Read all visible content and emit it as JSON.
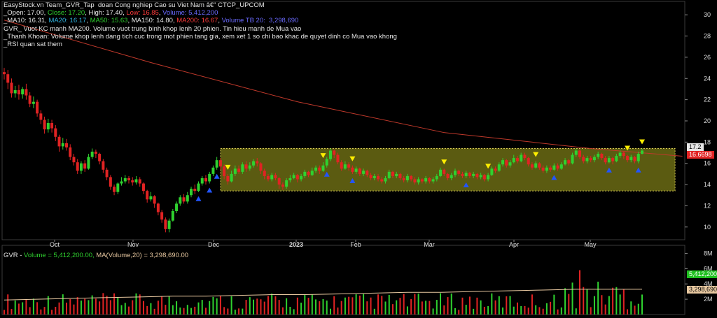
{
  "header": {
    "line1": "EasyStock.vn Team_GVR_Tap  doan Cong nghiep Cao su Viet Nam â€\" CTCP_UPCOM",
    "ohlc": {
      "open_label": "_Open: 17.00",
      "close_label": "Close: 17.20",
      "high_label": "High: 17.40",
      "low_label": "Low: 16.85",
      "volume_label": "Volume: 5,412,200"
    },
    "ma": {
      "ma10": "_MA10: 16.31",
      "ma20": "MA20: 16.17",
      "ma50": "MA50: 15.63",
      "ma150": "MA150: 14.80",
      "ma200": "MA200: 16.67",
      "vol_tb20": "Volume TB 20:  3,298,690"
    },
    "note1": "GVR_ Vuot KC manh MA200. Volume vuot trung binh khop lenh 20 phien. Tin hieu manh de Mua vao",
    "note2": "_Thanh Khoan: Volume khop lenh dang tich cuc trong mot phien tang gia, xem xet 1 so chi bao khac de quyet dinh co Mua vao khong",
    "note3": "_RSI quan sat them"
  },
  "volume_header": {
    "gvr_label": "GVR - ",
    "volume_text": "Volume = 5,412,200.00, ",
    "ma_text": "MA(Volume,20) = 3,298,690.00"
  },
  "price_tags": {
    "close": "17.2",
    "ma200": "16.6698"
  },
  "volume_tags": {
    "volume": "5,412,200",
    "ma": "3,298,690"
  },
  "colors": {
    "up": "#2fd12f",
    "down": "#e12323",
    "ma200": "#c0392b",
    "box": "#6b6b14",
    "buy_marker": "#2255ff",
    "sell_marker": "#ffee00",
    "vol_ma": "#e8c8a0"
  },
  "chart_data": {
    "type": "candlestick",
    "title": "GVR",
    "y_axis": {
      "ticks": [
        10,
        12,
        14,
        16,
        18,
        20,
        22,
        24,
        26,
        28,
        30
      ],
      "range": [
        8.8,
        31
      ]
    },
    "x_labels": [
      "Oct",
      "Nov",
      "Dec",
      "2023",
      "Feb",
      "Mar",
      "Apr",
      "May"
    ],
    "volume_axis": {
      "ticks": [
        "2M",
        "4M",
        "6M",
        "8M"
      ],
      "range": [
        0,
        8500000
      ]
    },
    "candles": [
      [
        24.6,
        24.4,
        25.0,
        23.9
      ],
      [
        24.4,
        23.6,
        24.8,
        23.0
      ],
      [
        23.6,
        22.6,
        24.0,
        22.2
      ],
      [
        22.6,
        22.9,
        23.3,
        22.2
      ],
      [
        22.9,
        22.5,
        23.4,
        22.0
      ],
      [
        22.5,
        23.0,
        23.2,
        22.1
      ],
      [
        23.0,
        22.4,
        23.5,
        22.0
      ],
      [
        22.4,
        21.6,
        22.7,
        21.3
      ],
      [
        21.6,
        21.8,
        22.3,
        21.2
      ],
      [
        21.8,
        20.7,
        22.0,
        20.4
      ],
      [
        20.7,
        20.1,
        21.0,
        19.7
      ],
      [
        20.1,
        19.2,
        20.4,
        18.8
      ],
      [
        19.2,
        19.8,
        20.2,
        18.9
      ],
      [
        19.8,
        19.3,
        20.1,
        18.9
      ],
      [
        19.3,
        18.5,
        19.6,
        18.1
      ],
      [
        18.5,
        17.6,
        18.7,
        17.1
      ],
      [
        17.6,
        17.9,
        18.4,
        17.3
      ],
      [
        17.9,
        17.5,
        18.3,
        17.2
      ],
      [
        17.5,
        16.6,
        17.8,
        16.3
      ],
      [
        16.6,
        16.1,
        16.9,
        15.8
      ],
      [
        16.1,
        15.3,
        16.4,
        15.0
      ],
      [
        15.3,
        16.0,
        16.2,
        15.0
      ],
      [
        16.0,
        15.5,
        16.3,
        15.2
      ],
      [
        15.5,
        16.6,
        16.9,
        15.4
      ],
      [
        16.6,
        17.1,
        17.4,
        16.4
      ],
      [
        17.1,
        16.9,
        17.3,
        16.5
      ],
      [
        16.9,
        16.2,
        17.0,
        15.9
      ],
      [
        16.2,
        15.4,
        16.4,
        15.1
      ],
      [
        15.4,
        14.7,
        15.6,
        14.4
      ],
      [
        14.7,
        13.8,
        14.9,
        13.5
      ],
      [
        13.8,
        13.3,
        14.0,
        13.0
      ],
      [
        13.3,
        14.1,
        14.2,
        13.1
      ],
      [
        14.1,
        14.3,
        14.7,
        13.9
      ],
      [
        14.3,
        14.6,
        14.9,
        14.1
      ],
      [
        14.6,
        14.4,
        14.8,
        14.1
      ],
      [
        14.4,
        14.2,
        14.7,
        13.9
      ],
      [
        14.2,
        14.5,
        14.8,
        14.0
      ],
      [
        14.5,
        14.1,
        14.7,
        13.8
      ],
      [
        14.1,
        13.4,
        14.2,
        13.1
      ],
      [
        13.4,
        12.6,
        13.5,
        12.3
      ],
      [
        12.6,
        12.9,
        13.3,
        12.4
      ],
      [
        12.9,
        12.2,
        13.0,
        11.8
      ],
      [
        12.2,
        11.4,
        12.3,
        11.1
      ],
      [
        11.4,
        10.7,
        11.6,
        10.4
      ],
      [
        10.7,
        9.8,
        10.9,
        9.5
      ],
      [
        9.8,
        10.6,
        10.8,
        9.5
      ],
      [
        10.6,
        11.5,
        11.7,
        10.5
      ],
      [
        11.5,
        12.2,
        12.4,
        11.3
      ],
      [
        12.2,
        12.8,
        13.0,
        12.0
      ],
      [
        12.8,
        12.4,
        13.1,
        12.2
      ],
      [
        12.4,
        13.0,
        13.3,
        12.2
      ],
      [
        13.0,
        13.6,
        13.8,
        12.8
      ],
      [
        13.6,
        13.4,
        14.0,
        13.1
      ],
      [
        13.4,
        14.1,
        14.3,
        13.3
      ],
      [
        14.1,
        14.6,
        14.8,
        13.9
      ],
      [
        14.6,
        14.3,
        14.9,
        14.0
      ],
      [
        14.3,
        15.0,
        15.2,
        14.1
      ],
      [
        15.0,
        15.6,
        15.8,
        14.8
      ],
      [
        15.6,
        16.3,
        16.6,
        15.4
      ],
      [
        16.3,
        15.7,
        16.5,
        15.4
      ],
      [
        15.7,
        14.8,
        15.9,
        14.5
      ],
      [
        14.8,
        14.3,
        15.0,
        14.0
      ],
      [
        14.3,
        15.0,
        15.3,
        14.2
      ],
      [
        15.0,
        15.5,
        15.8,
        14.8
      ],
      [
        15.5,
        15.2,
        15.8,
        15.0
      ],
      [
        15.2,
        15.9,
        16.1,
        15.0
      ],
      [
        15.9,
        15.5,
        16.2,
        15.2
      ],
      [
        15.5,
        15.8,
        16.1,
        15.3
      ],
      [
        15.8,
        16.2,
        16.4,
        15.6
      ],
      [
        16.2,
        16.0,
        16.5,
        15.7
      ],
      [
        16.0,
        15.3,
        16.1,
        15.0
      ],
      [
        15.3,
        14.8,
        15.5,
        14.5
      ],
      [
        14.8,
        14.5,
        15.0,
        14.3
      ],
      [
        14.5,
        14.9,
        15.1,
        14.3
      ],
      [
        14.9,
        14.6,
        15.1,
        14.4
      ],
      [
        14.6,
        14.0,
        14.7,
        13.6
      ],
      [
        14.0,
        13.8,
        14.2,
        13.5
      ],
      [
        13.8,
        14.4,
        14.6,
        13.6
      ],
      [
        14.4,
        14.6,
        14.9,
        14.2
      ],
      [
        14.6,
        14.9,
        15.1,
        14.5
      ],
      [
        14.9,
        14.5,
        15.0,
        14.2
      ],
      [
        14.5,
        14.8,
        15.0,
        14.3
      ],
      [
        14.8,
        15.2,
        15.4,
        14.6
      ],
      [
        15.2,
        14.9,
        15.3,
        14.7
      ],
      [
        14.9,
        15.3,
        15.6,
        14.8
      ],
      [
        15.3,
        15.6,
        15.8,
        15.1
      ],
      [
        15.6,
        15.3,
        15.8,
        15.0
      ],
      [
        15.3,
        15.8,
        16.1,
        15.2
      ],
      [
        15.8,
        16.4,
        16.6,
        15.6
      ],
      [
        16.4,
        17.2,
        17.4,
        16.2
      ],
      [
        17.2,
        16.8,
        17.3,
        16.5
      ],
      [
        16.8,
        16.1,
        17.0,
        15.9
      ],
      [
        16.1,
        15.5,
        16.3,
        15.3
      ],
      [
        15.5,
        15.9,
        16.2,
        15.4
      ],
      [
        15.9,
        15.6,
        16.1,
        15.3
      ],
      [
        15.6,
        15.2,
        15.8,
        15.0
      ],
      [
        15.2,
        15.5,
        15.7,
        15.0
      ],
      [
        15.5,
        15.0,
        15.6,
        14.8
      ],
      [
        15.0,
        15.3,
        15.5,
        14.8
      ],
      [
        15.3,
        14.9,
        15.4,
        14.7
      ],
      [
        14.9,
        14.6,
        15.1,
        14.4
      ],
      [
        14.6,
        14.8,
        15.0,
        14.4
      ],
      [
        14.8,
        14.5,
        15.0,
        14.3
      ],
      [
        14.5,
        14.3,
        14.7,
        14.1
      ],
      [
        14.3,
        14.6,
        14.8,
        14.1
      ],
      [
        14.6,
        15.2,
        15.4,
        14.5
      ],
      [
        15.2,
        14.8,
        15.3,
        14.6
      ],
      [
        14.8,
        15.0,
        15.2,
        14.6
      ],
      [
        15.0,
        14.6,
        15.1,
        14.4
      ],
      [
        14.6,
        14.4,
        14.8,
        14.2
      ],
      [
        14.4,
        14.8,
        15.0,
        14.2
      ],
      [
        14.8,
        14.5,
        14.9,
        14.3
      ],
      [
        14.5,
        14.2,
        14.7,
        14.0
      ],
      [
        14.2,
        14.5,
        14.7,
        14.0
      ],
      [
        14.5,
        14.3,
        14.6,
        14.1
      ],
      [
        14.3,
        14.6,
        14.8,
        14.1
      ],
      [
        14.6,
        14.3,
        14.7,
        14.1
      ],
      [
        14.3,
        14.5,
        14.7,
        14.1
      ],
      [
        14.5,
        14.8,
        15.0,
        14.3
      ],
      [
        14.8,
        15.4,
        15.6,
        14.7
      ],
      [
        15.4,
        15.0,
        15.5,
        14.8
      ],
      [
        15.0,
        14.6,
        15.1,
        14.4
      ],
      [
        14.6,
        14.9,
        15.1,
        14.4
      ],
      [
        14.9,
        15.3,
        15.5,
        14.7
      ],
      [
        15.3,
        15.0,
        15.4,
        14.8
      ],
      [
        15.0,
        14.8,
        15.2,
        14.6
      ],
      [
        14.8,
        15.1,
        15.3,
        14.6
      ],
      [
        15.1,
        14.8,
        15.2,
        14.6
      ],
      [
        14.8,
        15.0,
        15.2,
        14.6
      ],
      [
        15.0,
        14.7,
        15.1,
        14.5
      ],
      [
        14.7,
        14.9,
        15.1,
        14.5
      ],
      [
        14.9,
        14.5,
        15.0,
        14.3
      ],
      [
        14.5,
        14.9,
        15.1,
        14.3
      ],
      [
        14.9,
        15.5,
        15.7,
        14.8
      ],
      [
        15.5,
        15.3,
        15.7,
        15.1
      ],
      [
        15.3,
        15.9,
        16.1,
        15.2
      ],
      [
        15.9,
        16.3,
        16.5,
        15.7
      ],
      [
        16.3,
        15.8,
        16.4,
        15.6
      ],
      [
        15.8,
        16.1,
        16.3,
        15.6
      ],
      [
        16.1,
        16.5,
        16.8,
        16.0
      ],
      [
        16.5,
        16.2,
        16.7,
        16.0
      ],
      [
        16.2,
        16.8,
        17.0,
        16.1
      ],
      [
        16.8,
        16.5,
        17.0,
        16.3
      ],
      [
        16.5,
        15.9,
        16.6,
        15.7
      ],
      [
        15.9,
        15.6,
        16.1,
        15.4
      ],
      [
        15.6,
        16.0,
        16.2,
        15.5
      ],
      [
        16.0,
        15.6,
        16.1,
        15.4
      ],
      [
        15.6,
        15.3,
        15.8,
        15.1
      ],
      [
        15.3,
        15.6,
        15.8,
        15.1
      ],
      [
        15.6,
        15.4,
        15.8,
        15.2
      ],
      [
        15.4,
        15.8,
        16.0,
        15.3
      ],
      [
        15.8,
        15.5,
        16.0,
        15.3
      ],
      [
        15.5,
        15.9,
        16.1,
        15.4
      ],
      [
        15.9,
        16.3,
        16.5,
        15.8
      ],
      [
        16.3,
        16.0,
        16.4,
        15.8
      ],
      [
        16.0,
        16.8,
        17.0,
        15.9
      ],
      [
        16.8,
        17.2,
        17.4,
        16.6
      ],
      [
        17.2,
        16.6,
        17.3,
        16.4
      ],
      [
        16.6,
        16.2,
        16.8,
        16.0
      ],
      [
        16.2,
        16.5,
        16.7,
        16.0
      ],
      [
        16.5,
        16.3,
        16.7,
        16.1
      ],
      [
        16.3,
        16.6,
        16.8,
        16.1
      ],
      [
        16.6,
        16.9,
        17.1,
        16.4
      ],
      [
        16.9,
        16.5,
        17.0,
        16.3
      ],
      [
        16.5,
        16.1,
        16.7,
        15.9
      ],
      [
        16.1,
        16.5,
        16.7,
        16.0
      ],
      [
        16.5,
        16.2,
        16.6,
        15.9
      ],
      [
        16.2,
        16.7,
        16.9,
        16.1
      ],
      [
        16.7,
        17.0,
        17.2,
        16.5
      ],
      [
        17.0,
        16.7,
        17.1,
        16.4
      ],
      [
        16.7,
        16.3,
        16.8,
        16.1
      ],
      [
        16.3,
        16.6,
        16.8,
        16.1
      ],
      [
        16.6,
        16.2,
        16.7,
        16.0
      ],
      [
        16.2,
        16.9,
        17.1,
        16.0
      ],
      [
        16.9,
        17.2,
        17.4,
        16.85
      ]
    ],
    "volume_ma": [
      1.9,
      2.0,
      2.1,
      2.2,
      2.3,
      2.4,
      2.4,
      2.5,
      2.6,
      2.6,
      2.7,
      2.8,
      2.9,
      2.9,
      3.0,
      3.1,
      3.2,
      3.3,
      3.3,
      3.3
    ],
    "ma200_anchor_points": [
      [
        0,
        29.5
      ],
      [
        40,
        25.5
      ],
      [
        80,
        21.8
      ],
      [
        120,
        18.9
      ],
      [
        160,
        17.4
      ],
      [
        185,
        16.67
      ]
    ],
    "consolidation_box": {
      "start_index": 59,
      "end_index": 183,
      "top": 17.4,
      "bottom": 13.4
    },
    "buy_markers": [
      53,
      56,
      58,
      88,
      95,
      126,
      150,
      165,
      173,
      180
    ],
    "sell_markers": [
      61,
      87,
      95,
      120,
      132,
      145,
      170,
      184
    ]
  }
}
